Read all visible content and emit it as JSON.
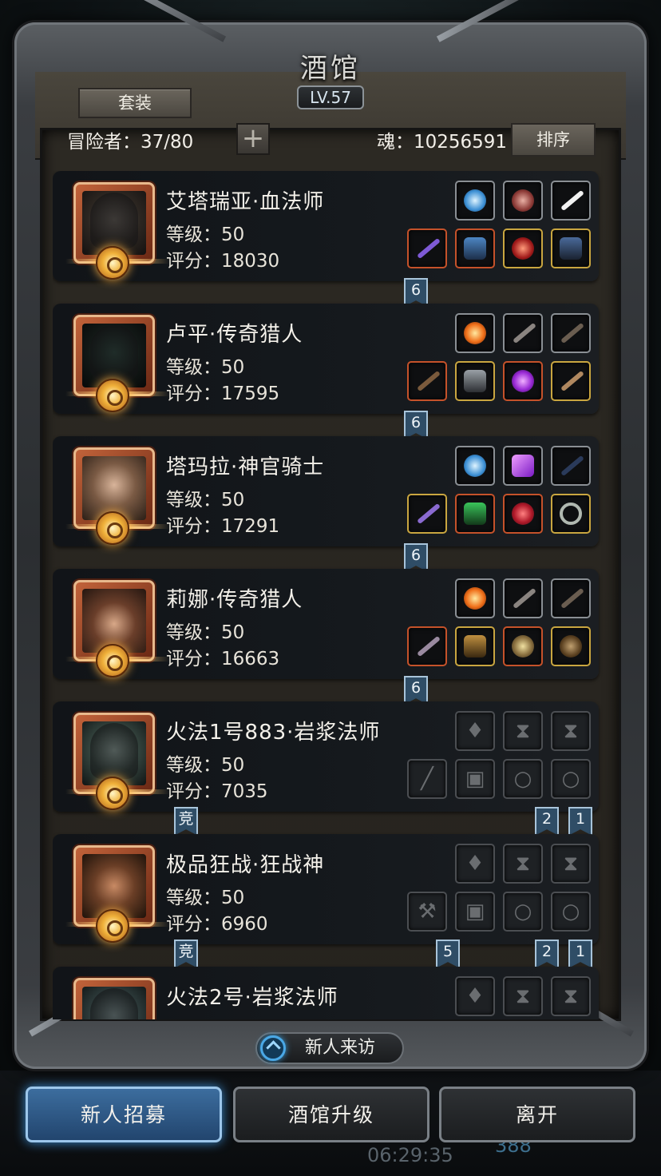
{
  "header": {
    "title": "酒馆",
    "level": "LV.57",
    "suit_button": "套装",
    "adventurers_label": "冒险者：37/80",
    "plus_label": "+",
    "soul_label": "魂：10256591",
    "sort_button": "排序"
  },
  "adventurers": [
    {
      "name": "艾塔瑞亚·血法师",
      "level": "等级：50",
      "score": "评分：18030",
      "ribbons": [
        "6"
      ]
    },
    {
      "name": "卢平·传奇猎人",
      "level": "等级：50",
      "score": "评分：17595",
      "ribbons": [
        "6"
      ]
    },
    {
      "name": "塔玛拉·神官骑士",
      "level": "等级：50",
      "score": "评分：17291",
      "ribbons": [
        "6"
      ]
    },
    {
      "name": "莉娜·传奇猎人",
      "level": "等级：50",
      "score": "评分：16663",
      "ribbons": [
        "6"
      ]
    },
    {
      "name": "火法1号883·岩浆法师",
      "level": "等级：50",
      "score": "评分：7035",
      "ribbons": [
        "竞",
        "2",
        "1"
      ]
    },
    {
      "name": "极品狂战·狂战神",
      "level": "等级：50",
      "score": "评分：6960",
      "ribbons": [
        "竞",
        "5",
        "2",
        "1"
      ]
    },
    {
      "name": "火法2号·岩浆法师",
      "level": "",
      "score": "",
      "ribbons": []
    }
  ],
  "visit_button": "新人来访",
  "bottom": {
    "recruit": "新人招募",
    "upgrade": "酒馆升级",
    "leave": "离开",
    "clock": "06:29:35",
    "gem_count": "388"
  },
  "colors": {
    "primary_button": "#2f5a86",
    "ribbon": "#2f4d66",
    "slot_gold": "#c9a640",
    "slot_red": "#c5522a",
    "medal": "#f0b13a"
  },
  "icons": [
    "shield-plus-icon",
    "orb-icon",
    "flame-icon",
    "gem-icon",
    "ring-icon",
    "staff-icon",
    "armor-icon",
    "axe-icon",
    "hourglass-icon"
  ]
}
